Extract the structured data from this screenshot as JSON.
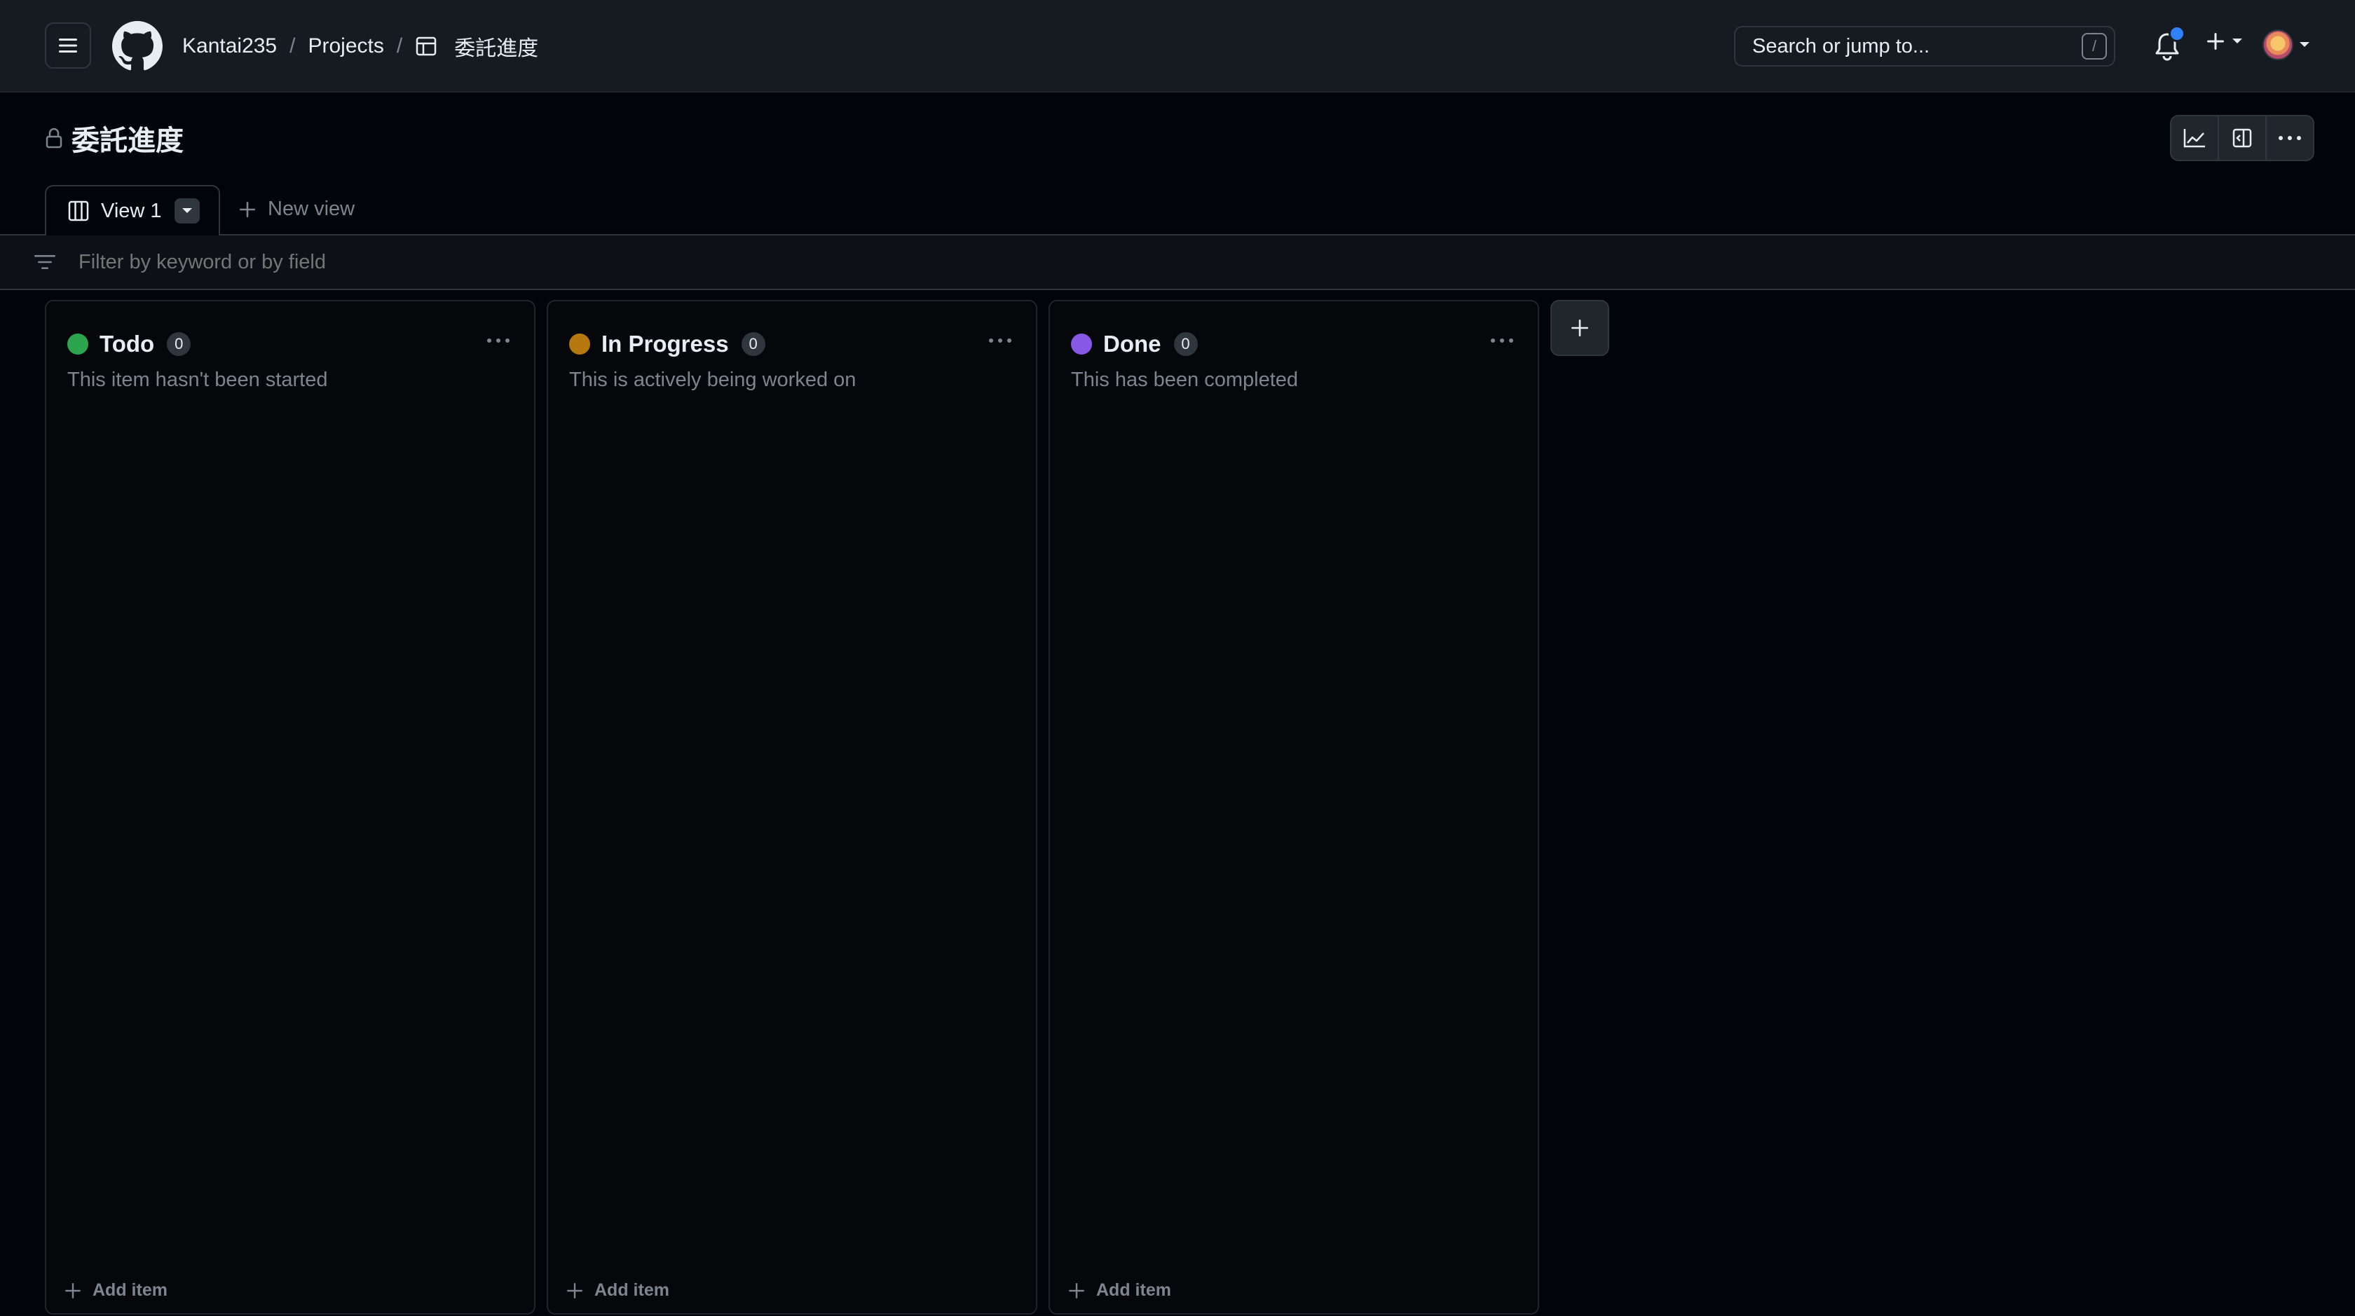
{
  "header": {
    "breadcrumb": {
      "owner": "Kantai235",
      "section": "Projects",
      "project": "委託進度",
      "separator": "/"
    },
    "search": {
      "placeholder": "Search or jump to...",
      "shortcut": "/"
    },
    "icons": [
      "hamburger-icon",
      "github-logo-icon",
      "table-icon",
      "bell-icon",
      "plus-icon",
      "chevron-down-icon",
      "avatar"
    ]
  },
  "project": {
    "title": "委託進度",
    "lock_icon": "lock-icon",
    "actions": [
      "insights-icon",
      "side-panel-icon",
      "kebab-icon"
    ]
  },
  "views": {
    "active_tab": "View 1",
    "new_view_label": "New view"
  },
  "filter": {
    "placeholder": "Filter by keyword or by field"
  },
  "columns": [
    {
      "name": "Todo",
      "count": "0",
      "description": "This item hasn't been started",
      "color": "#2da44e",
      "add_label": "Add item"
    },
    {
      "name": "In Progress",
      "count": "0",
      "description": "This is actively being worked on",
      "color": "#b7790f",
      "add_label": "Add item"
    },
    {
      "name": "Done",
      "count": "0",
      "description": "This has been completed",
      "color": "#8957e5",
      "add_label": "Add item"
    }
  ],
  "colors": {
    "background": "#010409",
    "header": "#161b22",
    "border": "#30363d",
    "muted_text": "#7d8590",
    "notification": "#2f81f7"
  }
}
